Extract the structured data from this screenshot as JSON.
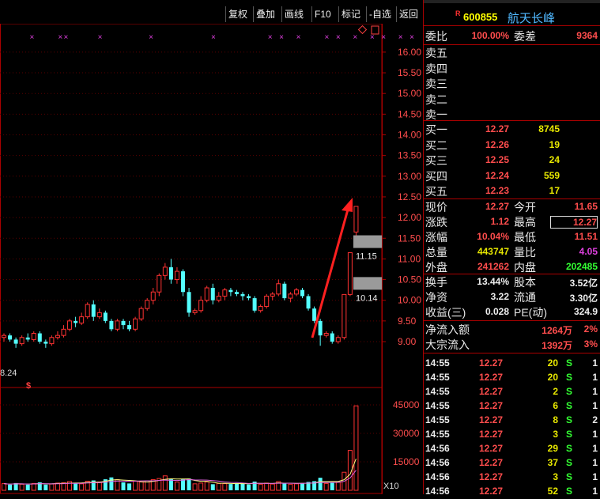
{
  "toolbar": {
    "buttons": [
      "复权",
      "叠加",
      "画线",
      "F10",
      "标记",
      "-自选",
      "返回"
    ]
  },
  "stock": {
    "code": "600855",
    "name": "航天长峰",
    "badge": "R"
  },
  "ratio": {
    "weibi_label": "委比",
    "weibi": "100.00%",
    "weicha_label": "委差",
    "weicha": "9364"
  },
  "sell": [
    {
      "label": "卖五",
      "price": "",
      "vol": ""
    },
    {
      "label": "卖四",
      "price": "",
      "vol": ""
    },
    {
      "label": "卖三",
      "price": "",
      "vol": ""
    },
    {
      "label": "卖二",
      "price": "",
      "vol": ""
    },
    {
      "label": "卖一",
      "price": "",
      "vol": ""
    }
  ],
  "buy": [
    {
      "label": "买一",
      "price": "12.27",
      "vol": "8745"
    },
    {
      "label": "买二",
      "price": "12.26",
      "vol": "19"
    },
    {
      "label": "买三",
      "price": "12.25",
      "vol": "24"
    },
    {
      "label": "买四",
      "price": "12.24",
      "vol": "559"
    },
    {
      "label": "买五",
      "price": "12.23",
      "vol": "17"
    }
  ],
  "quote": [
    {
      "l1": "现价",
      "v1": "12.27",
      "c1": "red",
      "l2": "今开",
      "v2": "11.65",
      "c2": "red"
    },
    {
      "l1": "涨跌",
      "v1": "1.12",
      "c1": "red",
      "l2": "最高",
      "v2": "12.27",
      "c2": "red"
    },
    {
      "l1": "涨幅",
      "v1": "10.04%",
      "c1": "red",
      "l2": "最低",
      "v2": "11.51",
      "c2": "red"
    },
    {
      "l1": "总量",
      "v1": "443747",
      "c1": "yel",
      "l2": "量比",
      "v2": "4.05",
      "c2": "mag"
    },
    {
      "l1": "外盘",
      "v1": "241262",
      "c1": "red",
      "l2": "内盘",
      "v2": "202485",
      "c2": "grn"
    }
  ],
  "fund": [
    {
      "l1": "换手",
      "v1": "13.44%",
      "l2": "股本",
      "v2": "3.52亿"
    },
    {
      "l1": "净资",
      "v1": "3.22",
      "l2": "流通",
      "v2": "3.30亿"
    },
    {
      "l1": "收益(三)",
      "v1": "0.028",
      "l2": "PE(动)",
      "v2": "324.9"
    }
  ],
  "flow": [
    {
      "label": "净流入额",
      "value": "1264万",
      "pct": "2%"
    },
    {
      "label": "大宗流入",
      "value": "1392万",
      "pct": "3%"
    }
  ],
  "ticks": [
    {
      "time": "14:55",
      "price": "12.27",
      "vol": "20",
      "side": "S",
      "n": "1"
    },
    {
      "time": "14:55",
      "price": "12.27",
      "vol": "20",
      "side": "S",
      "n": "1"
    },
    {
      "time": "14:55",
      "price": "12.27",
      "vol": "2",
      "side": "S",
      "n": "1"
    },
    {
      "time": "14:55",
      "price": "12.27",
      "vol": "6",
      "side": "S",
      "n": "1"
    },
    {
      "time": "14:55",
      "price": "12.27",
      "vol": "8",
      "side": "S",
      "n": "2"
    },
    {
      "time": "14:55",
      "price": "12.27",
      "vol": "3",
      "side": "S",
      "n": "1"
    },
    {
      "time": "14:56",
      "price": "12.27",
      "vol": "29",
      "side": "S",
      "n": "1"
    },
    {
      "time": "14:56",
      "price": "12.27",
      "vol": "37",
      "side": "S",
      "n": "1"
    },
    {
      "time": "14:56",
      "price": "12.27",
      "vol": "3",
      "side": "S",
      "n": "1"
    },
    {
      "time": "14:56",
      "price": "12.27",
      "vol": "52",
      "side": "S",
      "n": "1"
    }
  ],
  "chart_data": {
    "type": "candlestick",
    "price_axis": [
      "16.00",
      "15.50",
      "15.00",
      "14.50",
      "14.00",
      "13.50",
      "13.00",
      "12.50",
      "12.00",
      "11.50",
      "11.00",
      "10.50",
      "10.00",
      "9.50",
      "9.00"
    ],
    "price_range": [
      8.95,
      16.1
    ],
    "left_label": "8.24",
    "level_labels": [
      "11.15",
      "10.14"
    ],
    "volume_axis": [
      "45000",
      "30000",
      "15000"
    ],
    "volume_range": [
      0,
      50000
    ],
    "volume_multiplier": "X10",
    "candles": [
      [
        9.1,
        9.15,
        9.0,
        9.2
      ],
      [
        9.15,
        9.05,
        9.0,
        9.2
      ],
      [
        9.05,
        8.95,
        8.85,
        9.1
      ],
      [
        8.95,
        9.1,
        8.9,
        9.15
      ],
      [
        9.1,
        9.05,
        9.0,
        9.2
      ],
      [
        9.05,
        9.2,
        9.0,
        9.25
      ],
      [
        9.2,
        9.0,
        8.95,
        9.25
      ],
      [
        9.0,
        8.95,
        8.85,
        9.05
      ],
      [
        8.95,
        9.1,
        8.9,
        9.15
      ],
      [
        9.1,
        9.15,
        9.05,
        9.25
      ],
      [
        9.15,
        9.3,
        9.1,
        9.4
      ],
      [
        9.3,
        9.5,
        9.25,
        9.55
      ],
      [
        9.5,
        9.45,
        9.35,
        9.6
      ],
      [
        9.45,
        9.6,
        9.4,
        9.7
      ],
      [
        9.6,
        9.9,
        9.55,
        9.95
      ],
      [
        9.9,
        9.6,
        9.5,
        10.0
      ],
      [
        9.6,
        9.7,
        9.55,
        9.8
      ],
      [
        9.7,
        9.5,
        9.45,
        9.75
      ],
      [
        9.5,
        9.3,
        9.25,
        9.55
      ],
      [
        9.3,
        9.5,
        9.25,
        9.55
      ],
      [
        9.5,
        9.4,
        9.3,
        9.55
      ],
      [
        9.4,
        9.3,
        9.25,
        9.5
      ],
      [
        9.3,
        9.55,
        9.25,
        9.6
      ],
      [
        9.55,
        9.8,
        9.5,
        9.85
      ],
      [
        9.8,
        10.0,
        9.75,
        10.05
      ],
      [
        10.0,
        10.2,
        9.9,
        10.3
      ],
      [
        10.2,
        10.6,
        10.1,
        10.65
      ],
      [
        10.6,
        10.8,
        10.5,
        10.9
      ],
      [
        10.8,
        10.5,
        10.4,
        11.0
      ],
      [
        10.5,
        10.7,
        10.4,
        10.8
      ],
      [
        10.7,
        10.2,
        10.1,
        10.75
      ],
      [
        10.2,
        9.7,
        9.6,
        10.3
      ],
      [
        9.7,
        9.75,
        9.65,
        9.8
      ],
      [
        9.75,
        10.0,
        9.7,
        10.1
      ],
      [
        10.0,
        10.3,
        9.95,
        10.35
      ],
      [
        10.3,
        10.0,
        9.9,
        10.4
      ],
      [
        10.0,
        10.1,
        9.95,
        10.2
      ],
      [
        10.1,
        10.25,
        10.0,
        10.3
      ],
      [
        10.25,
        10.2,
        10.1,
        10.3
      ],
      [
        10.2,
        10.15,
        10.1,
        10.25
      ],
      [
        10.15,
        10.1,
        10.0,
        10.2
      ],
      [
        10.1,
        10.05,
        10.0,
        10.15
      ],
      [
        10.05,
        9.75,
        9.7,
        10.1
      ],
      [
        9.75,
        9.85,
        9.7,
        9.9
      ],
      [
        9.85,
        10.1,
        9.8,
        10.15
      ],
      [
        10.1,
        10.15,
        10.0,
        10.2
      ],
      [
        10.15,
        10.4,
        10.1,
        10.5
      ],
      [
        10.4,
        10.05,
        10.0,
        10.45
      ],
      [
        10.05,
        10.15,
        9.95,
        10.2
      ],
      [
        10.15,
        10.25,
        10.1,
        10.3
      ],
      [
        10.25,
        10.1,
        10.05,
        10.3
      ],
      [
        10.1,
        9.8,
        9.75,
        10.15
      ],
      [
        9.8,
        9.5,
        9.45,
        9.85
      ],
      [
        9.5,
        9.15,
        8.9,
        9.55
      ],
      [
        9.15,
        9.2,
        9.1,
        9.25
      ],
      [
        9.2,
        9.0,
        8.95,
        9.25
      ],
      [
        9.0,
        9.1,
        8.95,
        9.15
      ],
      [
        9.1,
        10.14,
        9.05,
        10.14
      ],
      [
        10.14,
        11.15,
        10.1,
        11.15
      ],
      [
        11.65,
        12.27,
        11.51,
        12.27
      ]
    ],
    "volumes": [
      3500,
      3000,
      3800,
      3200,
      3000,
      3600,
      4200,
      3000,
      3300,
      3800,
      4000,
      4600,
      3700,
      3400,
      4800,
      5200,
      4400,
      5800,
      6800,
      5600,
      4200,
      3600,
      4800,
      4400,
      5000,
      5600,
      6200,
      7600,
      6000,
      4400,
      5800,
      6200,
      3400,
      3800,
      4400,
      3200,
      3600,
      3500,
      3300,
      3800,
      3600,
      3100,
      4600,
      3200,
      3800,
      3300,
      4600,
      3800,
      3200,
      3400,
      3600,
      4400,
      4800,
      6600,
      3600,
      3900,
      4200,
      9500,
      21000,
      44500
    ],
    "markers_x_index": [
      3,
      8,
      9,
      15,
      24,
      35,
      45,
      47,
      50,
      55,
      57,
      60,
      63,
      65,
      68,
      70
    ]
  }
}
